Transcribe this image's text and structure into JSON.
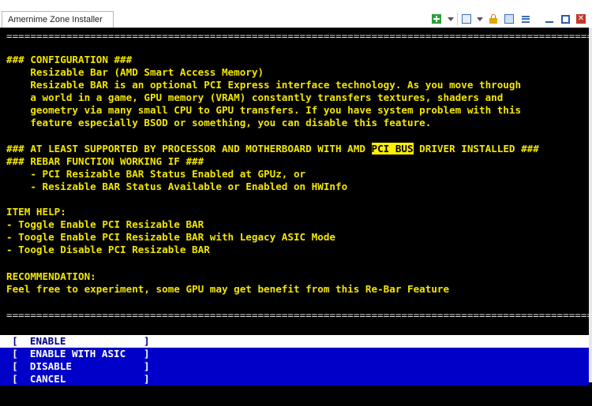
{
  "window": {
    "tab_title": "Amernime Zone Installer",
    "toolbar_icons": [
      "new-tab-icon",
      "dropdown-icon",
      "view-icon",
      "dropdown-icon",
      "lock-icon",
      "layout-icon",
      "menu-icon"
    ],
    "controls": [
      "minimize-icon",
      "maximize-icon",
      "close-icon"
    ]
  },
  "console": {
    "rule": "==================================================================================================",
    "lines": [
      "",
      "### CONFIGURATION ###",
      "    Resizable Bar (AMD Smart Access Memory)",
      "    Resizable BAR is an optional PCI Express interface technology. As you move through",
      "    a world in a game, GPU memory (VRAM) constantly transfers textures, shaders and",
      "    geometry via many small CPU to GPU transfers. If you have system problem with this",
      "    feature especially BSOD or something, you can disable this feature.",
      ""
    ],
    "support_prefix": "### AT LEAST SUPPORTED BY PROCESSOR AND MOTHERBOARD WITH AMD ",
    "support_highlight": "PCI BUS",
    "support_suffix": " DRIVER INSTALLED ###",
    "lines2": [
      "### REBAR FUNCTION WORKING IF ###",
      "    - PCI Resizable BAR Status Enabled at GPUz, or",
      "    - Resizable BAR Status Available or Enabled on HWInfo",
      "",
      "ITEM HELP:",
      "- Toggle Enable PCI Resizable BAR",
      "- Toogle Enable PCI Resizable BAR with Legacy ASIC Mode",
      "- Toogle Disable PCI Resizable BAR",
      "",
      "RECOMMENDATION:",
      "Feel free to experiment, some GPU may get benefit from this Re-Bar Feature"
    ]
  },
  "menu": {
    "items": [
      {
        "label": "  [  ENABLE             ]",
        "selected": true
      },
      {
        "label": "  [  ENABLE WITH ASIC   ]",
        "selected": false
      },
      {
        "label": "  [  DISABLE            ]",
        "selected": false
      },
      {
        "label": "  [  CANCEL             ]",
        "selected": false
      }
    ]
  },
  "colors": {
    "text": "#f3e600",
    "highlight": "#fff000",
    "menu_bg": "#0000c8",
    "menu_selected_bg": "#ffffff"
  }
}
